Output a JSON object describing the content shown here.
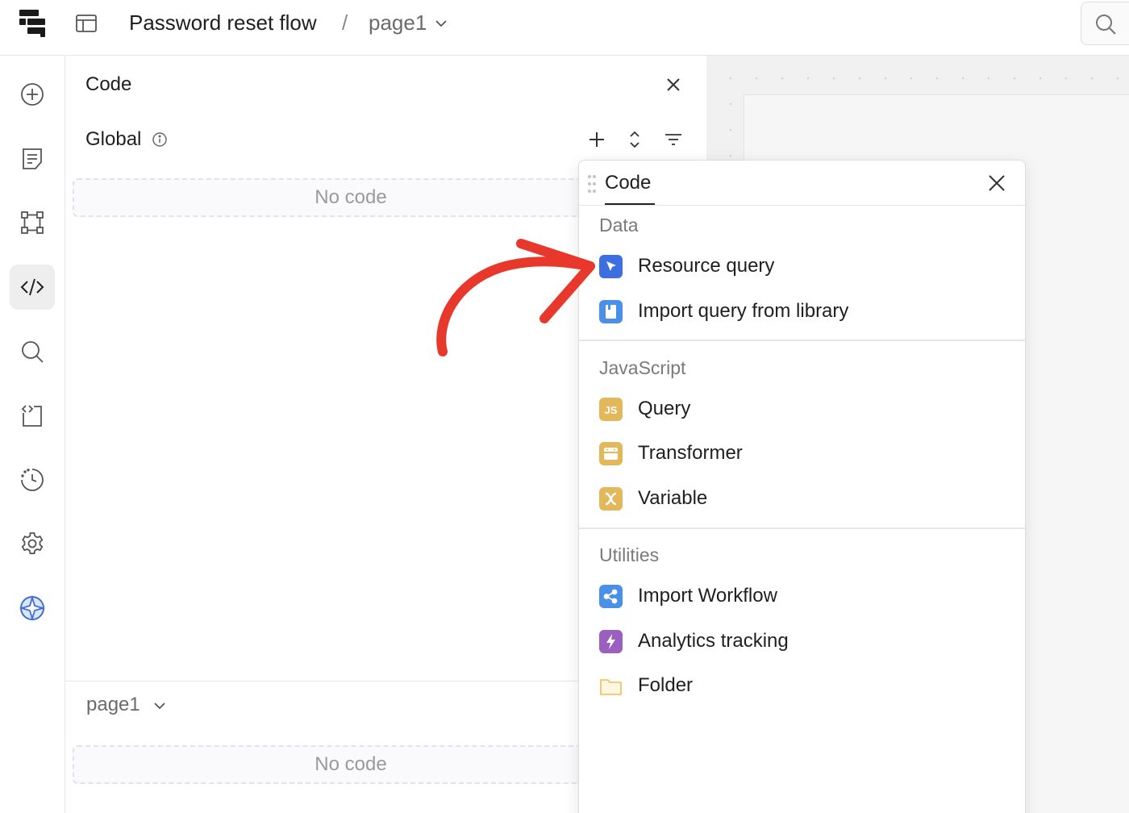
{
  "header": {
    "title": "Password reset flow",
    "separator": "/",
    "page": "page1"
  },
  "left_rail": {
    "items": [
      {
        "icon": "add-circle-icon"
      },
      {
        "icon": "notes-icon"
      },
      {
        "icon": "components-icon"
      },
      {
        "icon": "code-icon",
        "active": true
      },
      {
        "icon": "search-icon"
      },
      {
        "icon": "code-file-icon"
      },
      {
        "icon": "history-icon"
      },
      {
        "icon": "gear-icon"
      },
      {
        "icon": "assist-icon"
      }
    ]
  },
  "code_panel": {
    "title": "Code",
    "global_label": "Global",
    "global_empty": "No code",
    "page_label": "page1",
    "page_empty": "No code"
  },
  "popover": {
    "title": "Code",
    "sections": [
      {
        "label": "Data",
        "items": [
          {
            "label": "Resource query",
            "icon": "resource-query-icon",
            "color": "#3d6fe0"
          },
          {
            "label": "Import query from library",
            "icon": "library-icon",
            "color": "#4a8fe8"
          }
        ]
      },
      {
        "label": "JavaScript",
        "items": [
          {
            "label": "Query",
            "icon": "js-icon",
            "color": "#e2b85a"
          },
          {
            "label": "Transformer",
            "icon": "transformer-icon",
            "color": "#e2b85a"
          },
          {
            "label": "Variable",
            "icon": "variable-icon",
            "color": "#e2b85a"
          }
        ]
      },
      {
        "label": "Utilities",
        "items": [
          {
            "label": "Import Workflow",
            "icon": "workflow-icon",
            "color": "#4a8fe8"
          },
          {
            "label": "Analytics tracking",
            "icon": "analytics-icon",
            "color": "#9b5fc0"
          },
          {
            "label": "Folder",
            "icon": "folder-icon",
            "color": "#e8c15a"
          }
        ]
      }
    ]
  },
  "annotation": {
    "color": "#e8382c"
  }
}
